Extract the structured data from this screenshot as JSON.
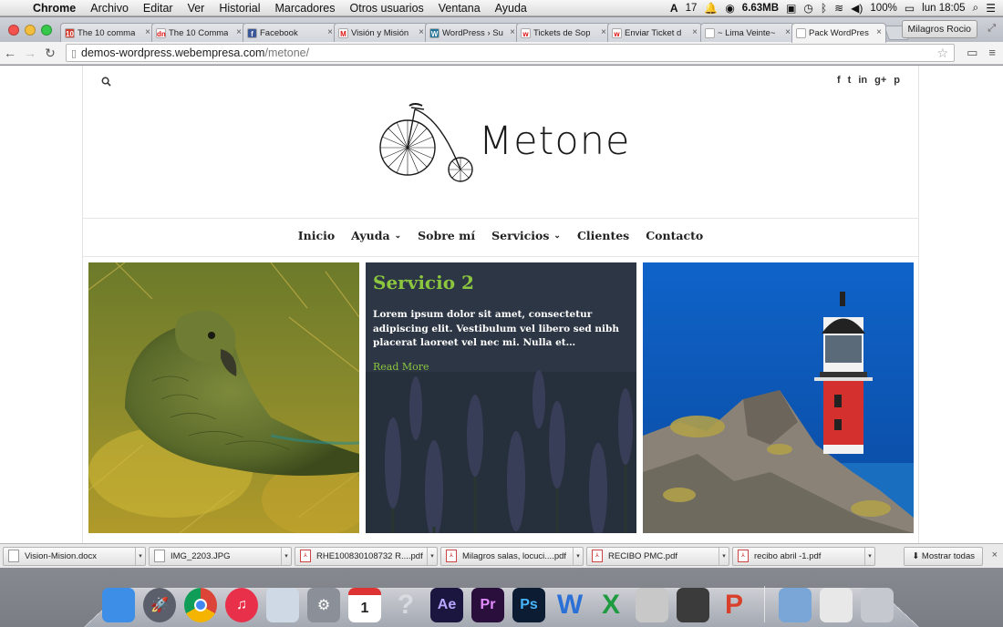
{
  "menubar": {
    "app_name": "Chrome",
    "items": [
      "Archivo",
      "Editar",
      "Ver",
      "Historial",
      "Marcadores",
      "Otros usuarios",
      "Ventana",
      "Ayuda"
    ],
    "status": {
      "adobe_count": "17",
      "memory": "6.63MB",
      "battery": "100%",
      "clock": "lun 18:05"
    }
  },
  "browser": {
    "tabs": [
      {
        "title": "The 10 comma",
        "favicon_color": "#d23f31",
        "favicon_text": "10"
      },
      {
        "title": "The 10 Comma",
        "favicon_color": "#ffffff",
        "favicon_text": "dn"
      },
      {
        "title": "Facebook",
        "favicon_color": "#3b5998",
        "favicon_text": "f"
      },
      {
        "title": "Visión y Misión",
        "favicon_color": "#ffffff",
        "favicon_text": "M"
      },
      {
        "title": "WordPress › Su",
        "favicon_color": "#21759b",
        "favicon_text": "W"
      },
      {
        "title": "Tickets de Sop",
        "favicon_color": "#ffffff",
        "favicon_text": "w"
      },
      {
        "title": "Enviar Ticket d",
        "favicon_color": "#ffffff",
        "favicon_text": "w"
      },
      {
        "title": "~ Lima Veinte~",
        "favicon_color": "#ffffff",
        "favicon_text": ""
      },
      {
        "title": "Pack WordPres",
        "favicon_color": "#ffffff",
        "favicon_text": ""
      }
    ],
    "active_tab_index": 8,
    "profile_name": "Milagros Rocio",
    "url_host": "demos-wordpress.webempresa.com",
    "url_path": "/metone/"
  },
  "site": {
    "brand": "Metone",
    "nav": [
      {
        "label": "Inicio",
        "has_dropdown": false
      },
      {
        "label": "Ayuda",
        "has_dropdown": true
      },
      {
        "label": "Sobre mí",
        "has_dropdown": false
      },
      {
        "label": "Servicios",
        "has_dropdown": true
      },
      {
        "label": "Clientes",
        "has_dropdown": false
      },
      {
        "label": "Contacto",
        "has_dropdown": false
      }
    ],
    "social_icons": [
      "facebook-icon",
      "twitter-icon",
      "linkedin-icon",
      "googleplus-icon",
      "pinterest-icon"
    ],
    "social_glyphs": [
      "f",
      "t",
      "in",
      "g+",
      "p"
    ],
    "featured": {
      "title": "Servicio 2",
      "excerpt": "Lorem ipsum dolor sit amet, consectetur adipiscing elit. Vestibulum vel libero sed nibh placerat laoreet vel nec mi. Nulla et…",
      "read_more": "Read More"
    },
    "accent_color": "#8cc63f"
  },
  "downloads": {
    "items": [
      {
        "name": "Vision-Mision.docx",
        "type": "docx"
      },
      {
        "name": "IMG_2203.JPG",
        "type": "jpg"
      },
      {
        "name": "RHE100830108732 R....pdf",
        "type": "pdf"
      },
      {
        "name": "Milagros salas, locuci....pdf",
        "type": "pdf"
      },
      {
        "name": "RECIBO PMC.pdf",
        "type": "pdf"
      },
      {
        "name": "recibo abril -1.pdf",
        "type": "pdf"
      }
    ],
    "show_all": "Mostrar todas"
  },
  "dock": {
    "icons": [
      {
        "name": "finder-icon",
        "color": "#3d8ee6",
        "glyph": ""
      },
      {
        "name": "launchpad-icon",
        "color": "#5a5f6b",
        "glyph": "🚀"
      },
      {
        "name": "chrome-icon",
        "color": "#4285f4",
        "glyph": ""
      },
      {
        "name": "itunes-icon",
        "color": "#e8304a",
        "glyph": "♫"
      },
      {
        "name": "safari-icon",
        "color": "#cfd9e6",
        "glyph": ""
      },
      {
        "name": "system-preferences-icon",
        "color": "#8a8f98",
        "glyph": "⚙"
      },
      {
        "name": "calendar-icon",
        "color": "#ffffff",
        "glyph": "1"
      },
      {
        "name": "unknown-app-icon",
        "color": "#9fa3aa",
        "glyph": "?"
      },
      {
        "name": "after-effects-icon",
        "color": "#1b1640",
        "glyph": "Ae"
      },
      {
        "name": "premiere-icon",
        "color": "#2a0f3d",
        "glyph": "Pr"
      },
      {
        "name": "photoshop-icon",
        "color": "#0b1c33",
        "glyph": "Ps"
      },
      {
        "name": "word-icon",
        "color": "#2b70d6",
        "glyph": "W"
      },
      {
        "name": "excel-icon",
        "color": "#1f9b3f",
        "glyph": "X"
      },
      {
        "name": "calculator-icon",
        "color": "#c8c8c8",
        "glyph": ""
      },
      {
        "name": "photo-booth-icon",
        "color": "#3b3b3b",
        "glyph": ""
      },
      {
        "name": "powerpoint-icon",
        "color": "#d8402b",
        "glyph": "P"
      },
      {
        "name": "downloads-folder-icon",
        "color": "#79a6d6",
        "glyph": ""
      },
      {
        "name": "spreadsheet-preview-icon",
        "color": "#e8e8e8",
        "glyph": ""
      },
      {
        "name": "trash-icon",
        "color": "#c5c9cf",
        "glyph": ""
      }
    ]
  }
}
